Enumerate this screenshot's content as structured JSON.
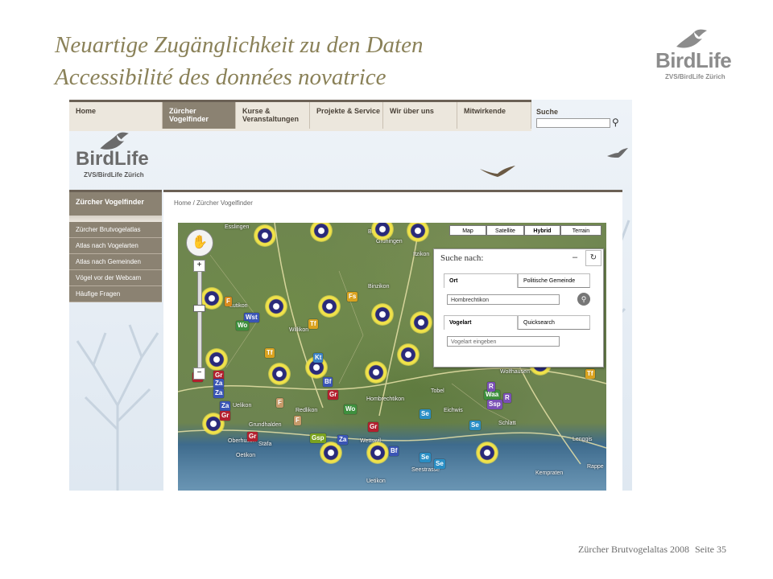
{
  "slide": {
    "title_de": "Neuartige Zugänglichkeit zu den Daten",
    "title_fr": "Accessibilité des données novatrice",
    "logo_word": "BirdLife",
    "logo_sub": "ZVS/BirdLife Zürich",
    "footer_text": "Zürcher Brutvogelaltas 2008",
    "footer_page": "Seite 35"
  },
  "site": {
    "nav": {
      "home": "Home",
      "items": [
        "Zürcher Vogelfinder",
        "Kurse & Veranstaltungen",
        "Projekte & Service",
        "Wir über uns",
        "Mitwirkende"
      ],
      "search_label": "Suche"
    },
    "logo_word": "BirdLife",
    "logo_sub": "ZVS/BirdLife Zürich",
    "sidenav": {
      "title": "Zürcher Vogelfinder",
      "items": [
        "Zürcher Brutvogelatlas",
        "Atlas nach Vogelarten",
        "Atlas nach Gemeinden",
        "Vögel vor der Webcam",
        "Häufige Fragen"
      ]
    },
    "breadcrumb": {
      "home": "Home",
      "sep": "/",
      "current": "Zürcher Vogelfinder"
    },
    "map": {
      "types": [
        "Map",
        "Satellite",
        "Hybrid",
        "Terrain"
      ],
      "selected_type": "Hybrid",
      "places": [
        "Esslingen",
        "Grüningen",
        "Binzikon",
        "Itzikon",
        "Wolfhausen",
        "Hombrechtikon",
        "Tobel",
        "Eichwis",
        "Schlatt",
        "Lenggis",
        "Kempraten",
        "Rappe",
        "Uetikon",
        "Stäfa",
        "Oetikon",
        "Oberhusen",
        "Grundhalden",
        "Redlikon",
        "Willikon",
        "Lutikon",
        "Uelikon",
        "Wettswil",
        "Bühl",
        "Seestrasse"
      ],
      "tags": [
        {
          "t": "F",
          "c": "#d98a1f"
        },
        {
          "t": "Wst",
          "c": "#3a55b5"
        },
        {
          "t": "Wo",
          "c": "#3e8f3e"
        },
        {
          "t": "Fs",
          "c": "#d9a21f"
        },
        {
          "t": "Tf",
          "c": "#d9a21f"
        },
        {
          "t": "Tf",
          "c": "#d9a21f"
        },
        {
          "t": "Kt",
          "c": "#3a80c4"
        },
        {
          "t": "Bf",
          "c": "#3a55b5"
        },
        {
          "t": "Gr",
          "c": "#b31f2e"
        },
        {
          "t": "Gr",
          "c": "#b31f2e"
        },
        {
          "t": "Gr",
          "c": "#b31f2e"
        },
        {
          "t": "Za",
          "c": "#3a55b5"
        },
        {
          "t": "Za",
          "c": "#3a55b5"
        },
        {
          "t": "Za",
          "c": "#3a55b5"
        },
        {
          "t": "Gr",
          "c": "#b31f2e"
        },
        {
          "t": "F",
          "c": "#c79a6a"
        },
        {
          "t": "F",
          "c": "#c79a6a"
        },
        {
          "t": "Wo",
          "c": "#3e8f3e"
        },
        {
          "t": "Gr",
          "c": "#b31f2e"
        },
        {
          "t": "Gr",
          "c": "#b31f2e"
        },
        {
          "t": "Gsp",
          "c": "#7aa21f"
        },
        {
          "t": "Za",
          "c": "#3a55b5"
        },
        {
          "t": "Bf",
          "c": "#3a55b5"
        },
        {
          "t": "Se",
          "c": "#2a8ec4"
        },
        {
          "t": "Se",
          "c": "#2a8ec4"
        },
        {
          "t": "Se",
          "c": "#2a8ec4"
        },
        {
          "t": "Se",
          "c": "#2a8ec4"
        },
        {
          "t": "Waa",
          "c": "#3e8f3e"
        },
        {
          "t": "Ssp",
          "c": "#7a4fb5"
        },
        {
          "t": "R",
          "c": "#7a4fb5"
        },
        {
          "t": "R",
          "c": "#7a4fb5"
        },
        {
          "t": "Tf",
          "c": "#d9a21f"
        }
      ]
    },
    "panel": {
      "title": "Suche nach:",
      "min": "–",
      "reset": "↻",
      "tab_ort": "Ort",
      "tab_gemeinde": "Politische Gemeinde",
      "ort_value": "Hombrechtikon",
      "tab_vogelart": "Vogelart",
      "tab_quick": "Quicksearch",
      "vogel_placeholder": "Vogelart eingeben"
    }
  }
}
